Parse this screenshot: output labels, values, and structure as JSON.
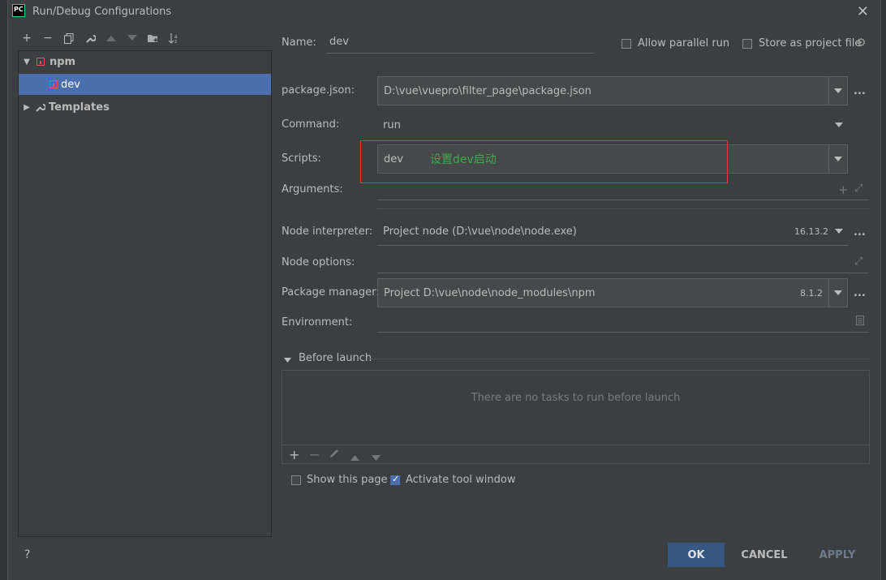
{
  "window": {
    "title": "Run/Debug Configurations",
    "logo_text": "PC"
  },
  "toolbar": {
    "icons": [
      "plus-icon",
      "minus-icon",
      "copy-icon",
      "wrench-icon",
      "arrow-up-icon",
      "arrow-down-icon",
      "folder-plus-icon",
      "sort-icon"
    ]
  },
  "tree": {
    "npm_label": "npm",
    "dev_label": "dev",
    "templates_label": "Templates"
  },
  "form": {
    "name_label": "Name:",
    "name_value": "dev",
    "allow_parallel_label": "Allow parallel run",
    "store_project_label": "Store as project file",
    "package_json_label": "package.json:",
    "package_json_value": "D:\\vue\\vuepro\\filter_page\\package.json",
    "command_label": "Command:",
    "command_value": "run",
    "scripts_label": "Scripts:",
    "scripts_value": "dev",
    "scripts_annotation": "设置dev启动",
    "arguments_label": "Arguments:",
    "node_interpreter_label": "Node interpreter:",
    "node_interpreter_value": "Project  node (D:\\vue\\node\\node.exe)",
    "node_version": "16.13.2",
    "node_options_label": "Node options:",
    "package_manager_label": "Package manager:",
    "package_manager_value": "Project   D:\\vue\\node\\node_modules\\npm",
    "package_manager_version": "8.1.2",
    "environment_label": "Environment:",
    "ellipsis": "..."
  },
  "before_launch": {
    "title": "Before launch",
    "empty_text": "There are no tasks to run before launch"
  },
  "bottom": {
    "show_page_label": "Show this page",
    "activate_tool_label": "Activate tool window",
    "activate_checked": true,
    "help": "?",
    "ok": "OK",
    "cancel": "CANCEL",
    "apply": "APPLY"
  },
  "colors": {
    "selection": "#4b6eaf",
    "annotation_green": "#3fa74f",
    "annotation_box": "#e03b3b",
    "ok_button": "#365880"
  }
}
